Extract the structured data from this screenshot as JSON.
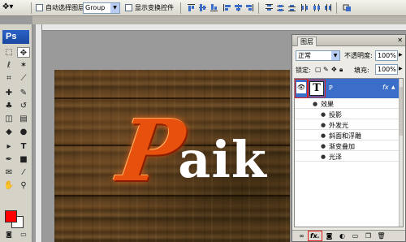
{
  "options_bar": {
    "auto_select_label": "自动选择图层",
    "auto_select_value": "Group",
    "show_transform_label": "显示变换控件"
  },
  "toolbox": {
    "logo": "Ps",
    "foreground_color": "#ff0000",
    "background_color": "#ffffff"
  },
  "canvas": {
    "art_text_first": "P",
    "art_text_rest": "aik"
  },
  "layers_panel": {
    "tab_label": "图层",
    "blend_mode": "正常",
    "opacity_label": "不透明度:",
    "opacity_value": "100%",
    "lock_label": "锁定:",
    "fill_label": "填充:",
    "fill_value": "100%",
    "layer": {
      "name": "P",
      "thumb_glyph": "T",
      "fx_badge": "fx"
    },
    "effects_group_label": "效果",
    "effects": [
      "投影",
      "外发光",
      "斜面和浮雕",
      "渐变叠加",
      "光泽"
    ],
    "bottom_fx_label": "fx."
  },
  "colors": {
    "selected_layer": "#3a6ec9",
    "highlight": "#e02020"
  }
}
